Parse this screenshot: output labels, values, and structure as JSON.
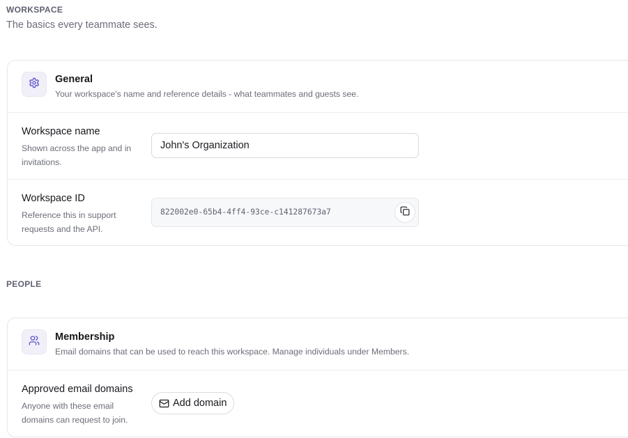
{
  "workspace_section": {
    "label": "WORKSPACE",
    "subtitle": "The basics every teammate sees."
  },
  "general_card": {
    "icon": "gear-icon",
    "title": "General",
    "description": "Your workspace's name and reference details - what teammates and guests see.",
    "name_row": {
      "label": "Workspace name",
      "help": "Shown across the app and in invitations.",
      "value": "John's Organization"
    },
    "id_row": {
      "label": "Workspace ID",
      "help": "Reference this in support requests and the API.",
      "value": "822002e0-65b4-4ff4-93ce-c141287673a7",
      "copy_icon": "copy-icon"
    }
  },
  "people_section": {
    "label": "PEOPLE"
  },
  "membership_card": {
    "icon": "users-icon",
    "title": "Membership",
    "description": "Email domains that can be used to reach this workspace. Manage individuals under Members.",
    "domains_row": {
      "label": "Approved email domains",
      "help": "Anyone with these email domains can request to join.",
      "button_label": "Add domain",
      "button_icon": "mail-icon"
    }
  },
  "colors": {
    "accent": "#5b4fcf",
    "border": "#e6e6ea",
    "muted_text": "#6b6d78",
    "icon_tile_bg": "#f1f0f8"
  }
}
